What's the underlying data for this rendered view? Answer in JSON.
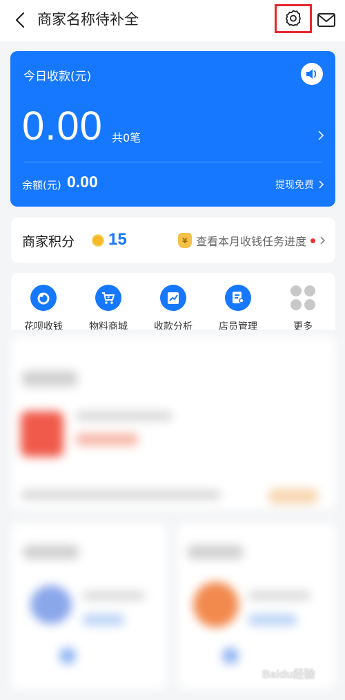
{
  "header": {
    "title": "商家名称待补全",
    "icons": [
      "back-arrow-icon",
      "settings-gear-icon",
      "mail-icon"
    ]
  },
  "pay_card": {
    "label": "今日收款(元)",
    "amount": "0.00",
    "count": "共0笔",
    "balance_label": "余额(元)",
    "balance_value": "0.00",
    "withdraw_label": "提现免费",
    "bg_color": "#1677ff"
  },
  "points": {
    "label": "商家积分",
    "value": "15",
    "task_link": "查看本月收钱任务进度"
  },
  "tools": [
    {
      "label": "花呗收钱",
      "icon": "huabei-icon"
    },
    {
      "label": "物料商城",
      "icon": "shop-cart-icon"
    },
    {
      "label": "收款分析",
      "icon": "chart-icon"
    },
    {
      "label": "店员管理",
      "icon": "staff-icon"
    },
    {
      "label": "更多",
      "icon": "more-grid-icon"
    }
  ],
  "watermark": "Baidu经验"
}
